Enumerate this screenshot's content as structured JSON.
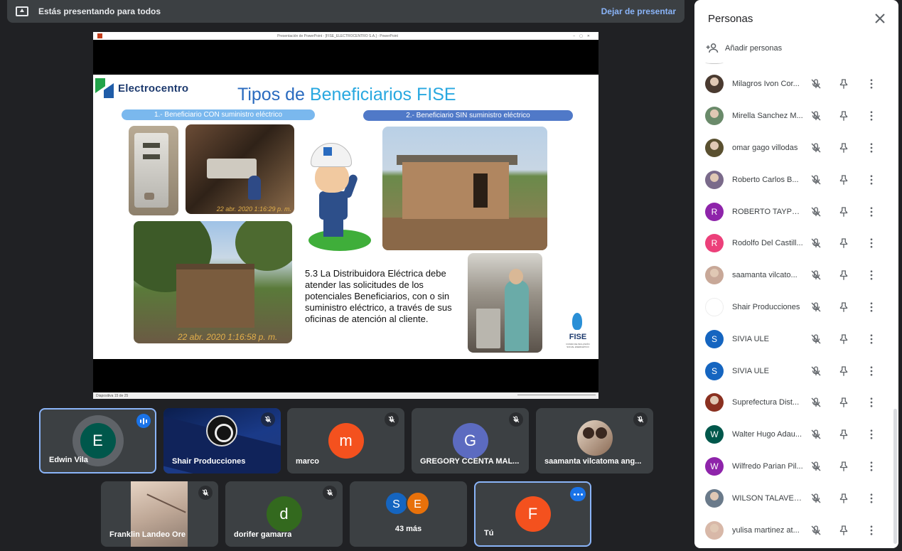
{
  "banner": {
    "text": "Estás presentando para todos",
    "stop_label": "Dejar de presentar"
  },
  "screen": {
    "window_title": "Presentación de PowerPoint - [FISE_ELECTROCENTRO S.A.] - PowerPoint",
    "status_text": "Diapositiva 15 de 25",
    "slide": {
      "logo_text": "Electrocentro",
      "title_part1": "Tipos de ",
      "title_part2": "Beneficiarios FISE",
      "pill_left": "1.- Beneficiario CON suministro eléctrico",
      "pill_right": "2.- Beneficiario SIN suministro eléctrico",
      "stamp_1": "22 abr. 2020 1:16:29 p. m.",
      "stamp_2": "22 abr. 2020 1:16:58 p. m.",
      "body": "5.3 La Distribuidora Eléctrica debe atender las solicitudes de los potenciales Beneficiarios, con o sin suministro eléctrico, a través de sus oficinas de atención al cliente.",
      "fise_text": "FISE",
      "fise_sub": "FONDO DE INCLUSIÓN SOCIAL ENERGÉTICO"
    }
  },
  "tiles": {
    "edwin": {
      "initial": "E",
      "name": "Edwin Vila",
      "color": "#00574b"
    },
    "shair": {
      "name": "Shair Producciones"
    },
    "marco": {
      "initial": "m",
      "name": "marco",
      "color": "#f4511e"
    },
    "gregory": {
      "initial": "G",
      "name": "GREGORY CCENTA MAL...",
      "color": "#5c6bc0"
    },
    "saamanta": {
      "name": "saamanta vilcatoma ang..."
    },
    "franklin": {
      "name": "Franklin Landeo Ore"
    },
    "dorifer": {
      "initial": "d",
      "name": "dorifer gamarra",
      "color": "#33691e"
    },
    "more": {
      "a": "S",
      "b": "E",
      "label": "43 más",
      "color_a": "#1565c0",
      "color_b": "#e8710a"
    },
    "you": {
      "initial": "F",
      "name": "Tú",
      "color": "#f4511e"
    }
  },
  "panel": {
    "title": "Personas",
    "add_label": "Añadir personas",
    "people": [
      {
        "name": "Milagros Ivon Cor...",
        "initial": "",
        "color": "#4a3a30",
        "photo": true
      },
      {
        "name": "Mirella Sanchez M...",
        "initial": "",
        "color": "#6a8a6a",
        "photo": true
      },
      {
        "name": "omar gago villodas",
        "initial": "",
        "color": "#5a5030",
        "photo": true
      },
      {
        "name": "Roberto Carlos B...",
        "initial": "",
        "color": "#7a6a8a",
        "photo": true
      },
      {
        "name": "ROBERTO TAYPE ...",
        "initial": "R",
        "color": "#8e24aa",
        "photo": false
      },
      {
        "name": "Rodolfo Del Castill...",
        "initial": "R",
        "color": "#ec407a",
        "photo": false
      },
      {
        "name": "saamanta vilcato...",
        "initial": "",
        "color": "#c8a898",
        "photo": true
      },
      {
        "name": "Shair Producciones",
        "initial": "",
        "color": "#ffffff",
        "photo": true
      },
      {
        "name": "SIVIA ULE",
        "initial": "S",
        "color": "#1565c0",
        "photo": false
      },
      {
        "name": "SIVIA ULE",
        "initial": "S",
        "color": "#1565c0",
        "photo": false
      },
      {
        "name": "Suprefectura Dist...",
        "initial": "",
        "color": "#8a3020",
        "photo": true
      },
      {
        "name": "Walter Hugo Adau...",
        "initial": "W",
        "color": "#00574b",
        "photo": false
      },
      {
        "name": "Wilfredo Parian Pil...",
        "initial": "W",
        "color": "#8e24aa",
        "photo": false
      },
      {
        "name": "WILSON TALAVER...",
        "initial": "",
        "color": "#6a7a8a",
        "photo": true
      },
      {
        "name": "yulisa martinez at...",
        "initial": "",
        "color": "#d8b8a8",
        "photo": true
      }
    ]
  }
}
